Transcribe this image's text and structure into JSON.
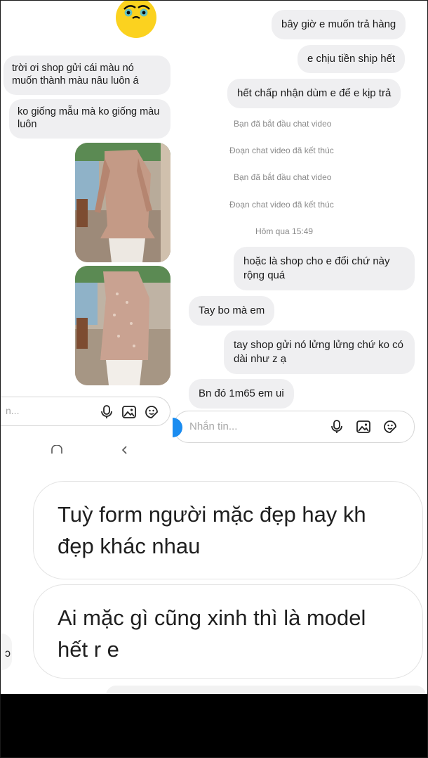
{
  "left_chat": {
    "messages": [
      "trời ơi shop gửi cái màu nó muốn thành màu nâu luôn á",
      "ko giống mẫu mà ko giống màu luôn"
    ],
    "input_placeholder": "n..."
  },
  "right_chat": {
    "outgoing": [
      "bây giờ e muốn trả hàng",
      "e chịu tiền ship hết",
      "hết chấp nhận dùm e để e kịp trả"
    ],
    "system_events": [
      "Bạn đã bắt đầu chat video",
      "Đoạn chat video đã kết thúc",
      "Bạn đã bắt đầu chat video",
      "Đoạn chat video đã kết thúc"
    ],
    "timestamp": "Hôm qua 15:49",
    "conversation": [
      {
        "from": "me",
        "text": "hoặc là shop cho e đổi chứ này rộng quá"
      },
      {
        "from": "shop",
        "text": "Tay bo mà em"
      },
      {
        "from": "me",
        "text": "tay shop gửi nó lửng lửng chứ ko có dài như z ạ"
      },
      {
        "from": "shop",
        "text": "Bn đó 1m65 em ui"
      }
    ],
    "input_placeholder": "Nhắn tin..."
  },
  "bottom_chat": {
    "messages": [
      "Tuỳ form người mặc đẹp hay kh đẹp khác nhau",
      "Ai mặc gì cũng xinh thì là model hết r e"
    ],
    "edge_glyph": "ɔ"
  },
  "colors": {
    "bubble": "#efeff1",
    "system_text": "#8a8a8a",
    "placeholder": "#a8a8a8",
    "dress": "#c49a86",
    "black_band": "#000000"
  },
  "icons": [
    "emoji-avatar-icon",
    "mic-icon",
    "image-icon",
    "sticker-icon",
    "home-nav-icon",
    "back-nav-icon",
    "camera-icon"
  ]
}
